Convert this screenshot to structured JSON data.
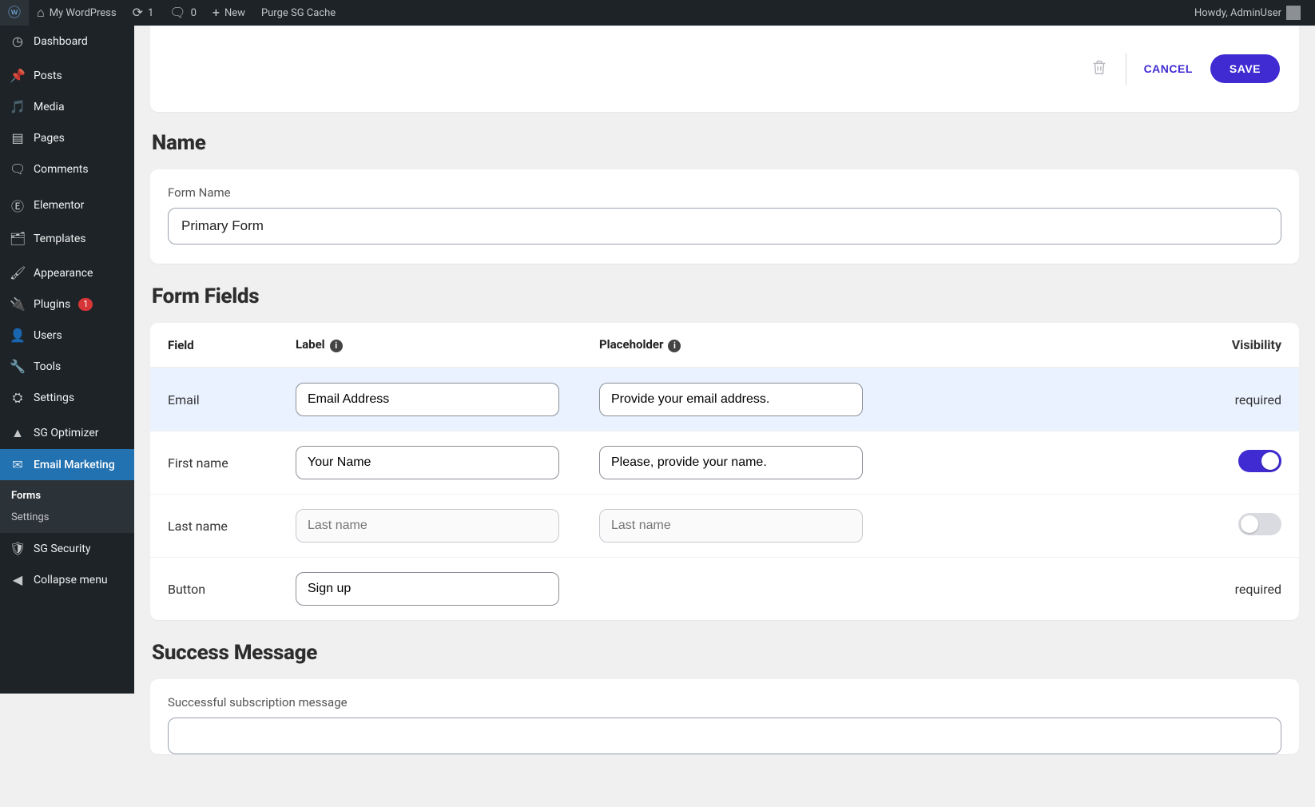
{
  "adminbar": {
    "site_name": "My WordPress",
    "updates": "1",
    "comments": "0",
    "new_label": "New",
    "purge_label": "Purge SG Cache",
    "howdy": "Howdy, AdminUser"
  },
  "sidebar": {
    "items": [
      {
        "label": "Dashboard",
        "icon": "dashboard"
      },
      {
        "label": "Posts",
        "icon": "pin"
      },
      {
        "label": "Media",
        "icon": "media"
      },
      {
        "label": "Pages",
        "icon": "page"
      },
      {
        "label": "Comments",
        "icon": "comment"
      },
      {
        "label": "Elementor",
        "icon": "elementor"
      },
      {
        "label": "Templates",
        "icon": "templates"
      },
      {
        "label": "Appearance",
        "icon": "brush"
      },
      {
        "label": "Plugins",
        "icon": "plug",
        "badge": "1"
      },
      {
        "label": "Users",
        "icon": "user"
      },
      {
        "label": "Tools",
        "icon": "wrench"
      },
      {
        "label": "Settings",
        "icon": "sliders"
      },
      {
        "label": "SG Optimizer",
        "icon": "sg"
      },
      {
        "label": "Email Marketing",
        "icon": "mail",
        "active": true
      },
      {
        "label": "SG Security",
        "icon": "shield"
      },
      {
        "label": "Collapse menu",
        "icon": "collapse"
      }
    ],
    "submenu": [
      {
        "label": "Forms",
        "current": true
      },
      {
        "label": "Settings",
        "current": false
      }
    ]
  },
  "toolbar": {
    "cancel": "CANCEL",
    "save": "SAVE"
  },
  "sections": {
    "name": "Name",
    "fields": "Form Fields",
    "success": "Success Message"
  },
  "name_panel": {
    "label": "Form Name",
    "value": "Primary Form"
  },
  "table": {
    "head": {
      "field": "Field",
      "label": "Label",
      "placeholder": "Placeholder",
      "visibility": "Visibility"
    },
    "rows": [
      {
        "field": "Email",
        "label": "Email Address",
        "placeholder": "Provide your email address.",
        "vis_text": "required",
        "hl": true
      },
      {
        "field": "First name",
        "label": "Your Name",
        "placeholder": "Please, provide your name.",
        "toggle": "on"
      },
      {
        "field": "Last name",
        "label_ph": "Last name",
        "placeholder_ph": "Last name",
        "toggle": "off",
        "disabled": true
      },
      {
        "field": "Button",
        "label": "Sign up",
        "vis_text": "required",
        "no_ph": true
      }
    ]
  },
  "success_panel": {
    "label": "Successful subscription message"
  }
}
